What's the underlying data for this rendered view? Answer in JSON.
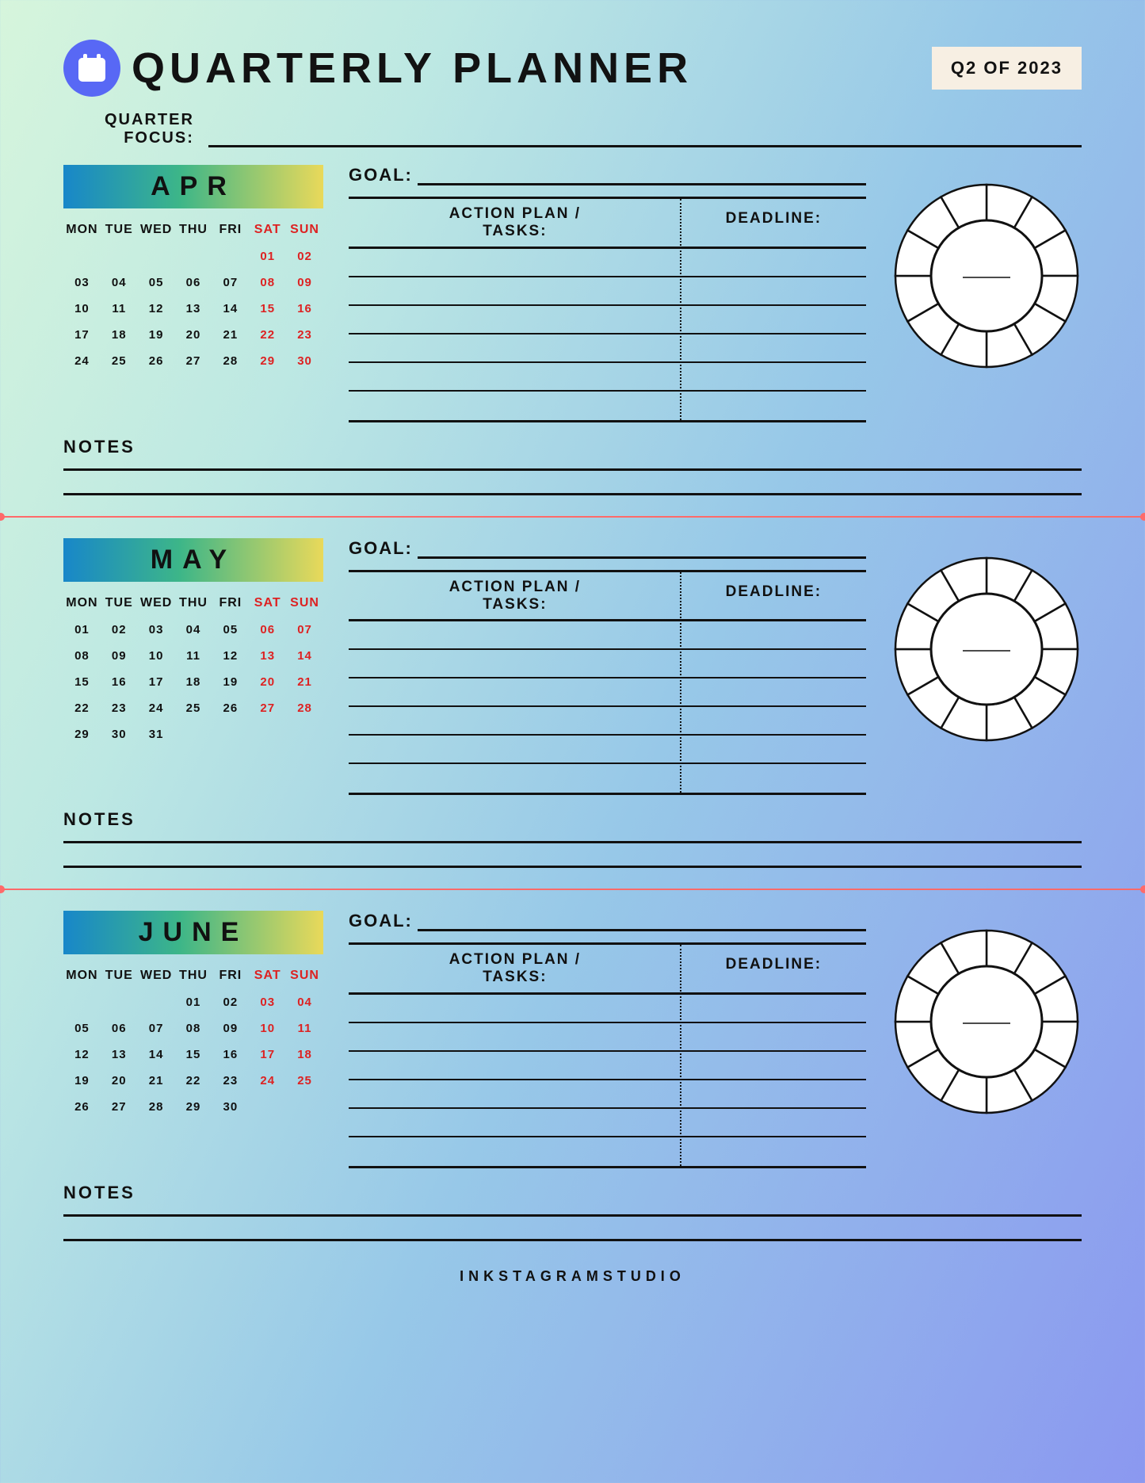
{
  "header": {
    "title": "QUARTERLY PLANNER",
    "badge": "Q2 OF 2023"
  },
  "focus_label": "QUARTER\nFOCUS:",
  "labels": {
    "goal": "GOAL:",
    "action": "ACTION PLAN /\nTASKS:",
    "deadline": "DEADLINE:",
    "notes": "NOTES"
  },
  "weekdays": [
    "MON",
    "TUE",
    "WED",
    "THU",
    "FRI",
    "SAT",
    "SUN"
  ],
  "months": [
    {
      "name": "APR",
      "start": 5,
      "days": 30
    },
    {
      "name": "MAY",
      "start": 0,
      "days": 31
    },
    {
      "name": "JUNE",
      "start": 3,
      "days": 30
    }
  ],
  "footer": "INKSTAGRAMSTUDIO"
}
